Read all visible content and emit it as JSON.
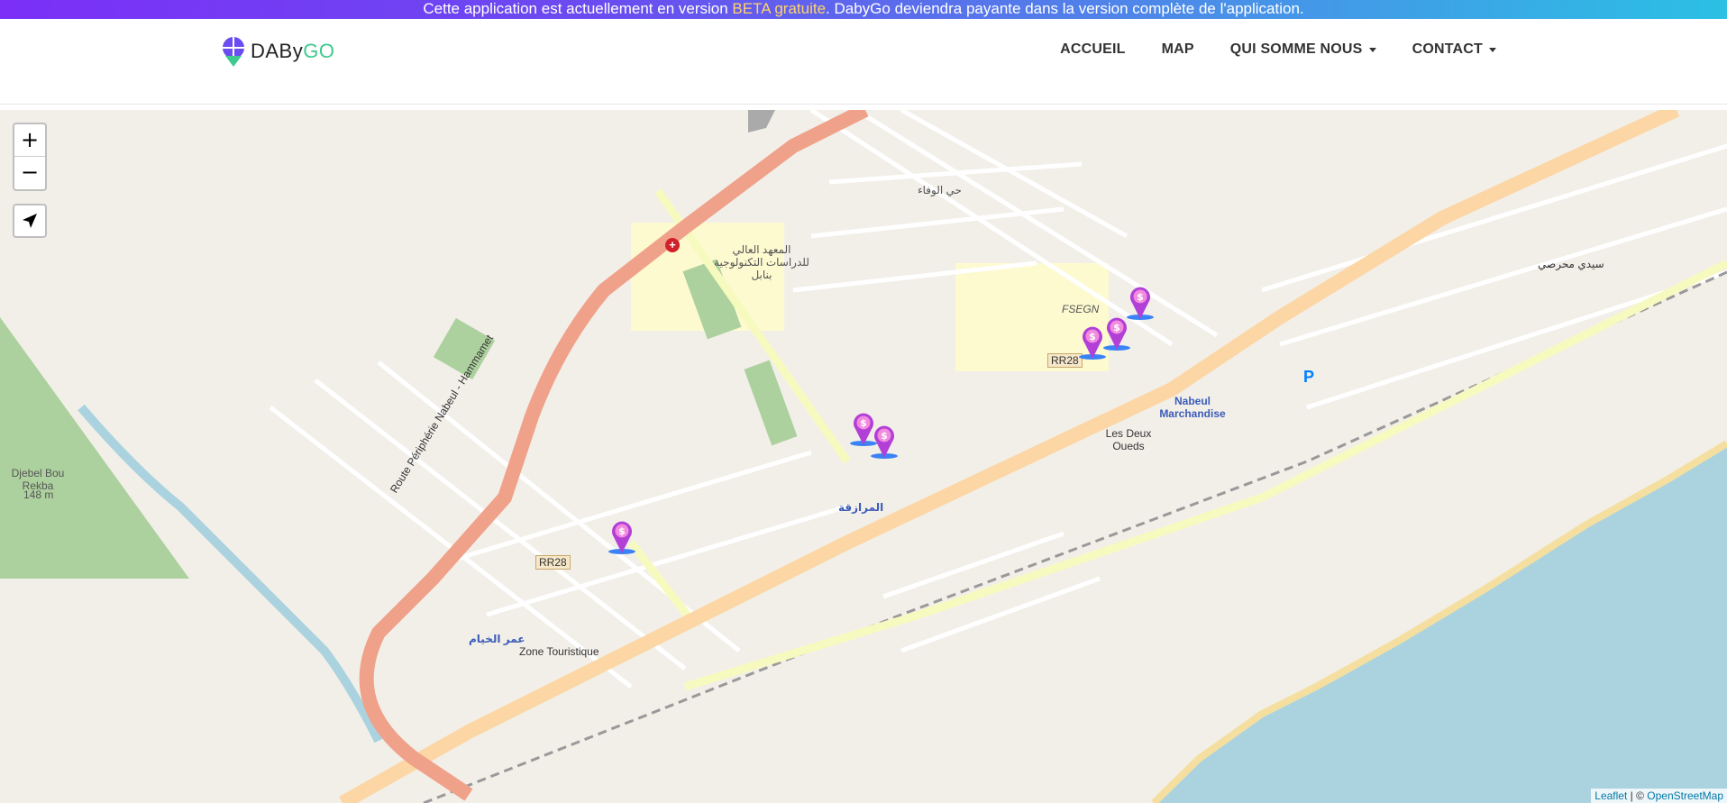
{
  "banner": {
    "text_before": "Cette application est actuellement en version ",
    "highlight": "BETA gratuite",
    "text_after": ". DabyGo deviendra payante dans la version complète de l'application."
  },
  "brand": {
    "name_part1": "DABy",
    "name_part2": "GO"
  },
  "nav": {
    "items": [
      {
        "label": "ACCUEIL",
        "dropdown": false
      },
      {
        "label": "MAP",
        "dropdown": false
      },
      {
        "label": "QUI SOMME NOUS",
        "dropdown": true
      },
      {
        "label": "CONTACT",
        "dropdown": true
      }
    ]
  },
  "map": {
    "controls": {
      "zoom_in": "+",
      "zoom_out": "−",
      "locate_icon": "location-arrow-icon"
    },
    "labels": {
      "route_label": "Route Périphérie Nabeul - Hammamet",
      "rr28_a": "RR28",
      "rr28_b": "RR28",
      "fsegn": "FSEGN",
      "institute": "المعهد العالي للدراسات التكنولوجية بنابل",
      "hay_wafa": "حي الوفاء",
      "nabeul_marchandise": "Nabeul Marchandise",
      "les_deux_oueds": "Les Deux Oueds",
      "djebel": "Djebel Bou Rekba",
      "djebel_alt": "148 m",
      "zone_touristique": "Zone Touristique",
      "omar_khayam": "عمر الخيام",
      "marazka": "المرازقة",
      "sidi_mahrsi": "سيدي محرصي",
      "parking": "P"
    },
    "markers": [
      {
        "icon": "dollar-pin-icon"
      },
      {
        "icon": "dollar-pin-icon"
      },
      {
        "icon": "dollar-pin-icon"
      },
      {
        "icon": "dollar-pin-icon"
      },
      {
        "icon": "dollar-pin-icon"
      },
      {
        "icon": "dollar-pin-icon"
      }
    ],
    "attribution": {
      "leaflet": "Leaflet",
      "sep": " | © ",
      "osm": "OpenStreetMap"
    }
  },
  "colors": {
    "marker_magenta": "#d63fd6",
    "marker_blue": "#3b82f6",
    "brand_green": "#3ec98f",
    "sea": "#aad3df"
  }
}
